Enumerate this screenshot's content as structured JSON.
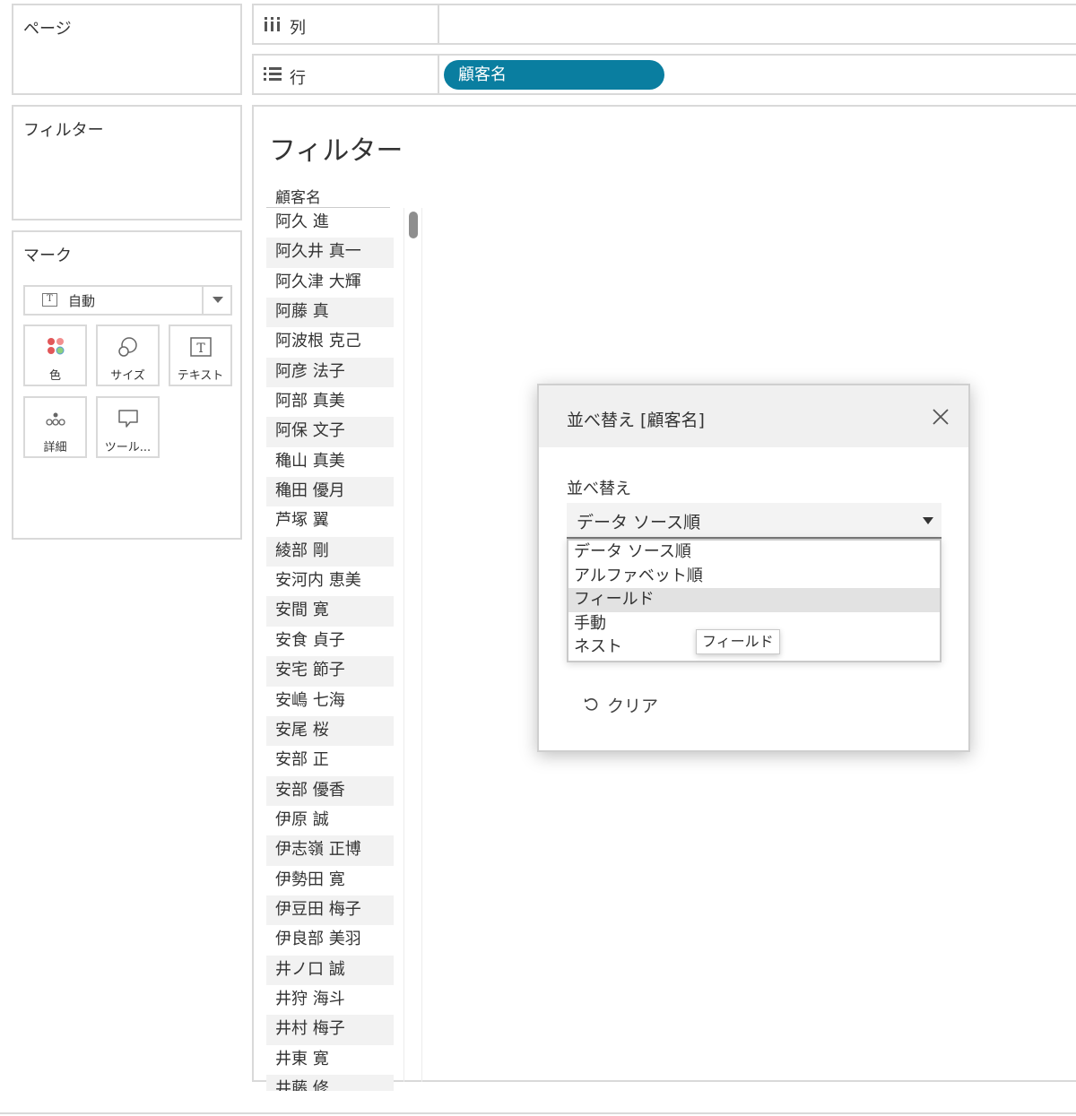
{
  "side_cards": {
    "pages_title": "ページ",
    "filters_title": "フィルター",
    "marks_title": "マーク",
    "mark_type": "自動",
    "mark_buttons": [
      {
        "label": "色",
        "icon": "color-dots-icon"
      },
      {
        "label": "サイズ",
        "icon": "size-circles-icon"
      },
      {
        "label": "テキスト",
        "icon": "text-t-icon"
      },
      {
        "label": "詳細",
        "icon": "detail-dots-icon"
      },
      {
        "label": "ツール...",
        "icon": "tooltip-bubble-icon"
      }
    ]
  },
  "shelves": {
    "columns_label": "列",
    "rows_label": "行",
    "rows_pill": "顧客名"
  },
  "view": {
    "title": "フィルター",
    "column_header": "顧客名",
    "names": [
      "阿久 進",
      "阿久井 真一",
      "阿久津 大輝",
      "阿藤 真",
      "阿波根 克己",
      "阿彦 法子",
      "阿部 真美",
      "阿保 文子",
      "穐山 真美",
      "穐田 優月",
      "芦塚 翼",
      "綾部 剛",
      "安河内 恵美",
      "安間 寛",
      "安食 貞子",
      "安宅 節子",
      "安嶋 七海",
      "安尾 桜",
      "安部 正",
      "安部 優香",
      "伊原 誠",
      "伊志嶺 正博",
      "伊勢田 寛",
      "伊豆田 梅子",
      "伊良部 美羽",
      "井ノ口 誠",
      "井狩 海斗",
      "井村 梅子",
      "井東 寛",
      "井藤 修"
    ]
  },
  "sort_dialog": {
    "title": "並べ替え [顧客名]",
    "sort_by_label": "並べ替え",
    "selected": "データ ソース順",
    "options": [
      "データ ソース順",
      "アルファベット順",
      "フィールド",
      "手動",
      "ネスト"
    ],
    "highlighted_option": "フィールド",
    "tooltip": "フィールド",
    "clear_label": "クリア"
  },
  "colors": {
    "pill": "#0a7ea0",
    "panel_border": "#d9d9d9",
    "highlight": "#e2e2e2"
  }
}
